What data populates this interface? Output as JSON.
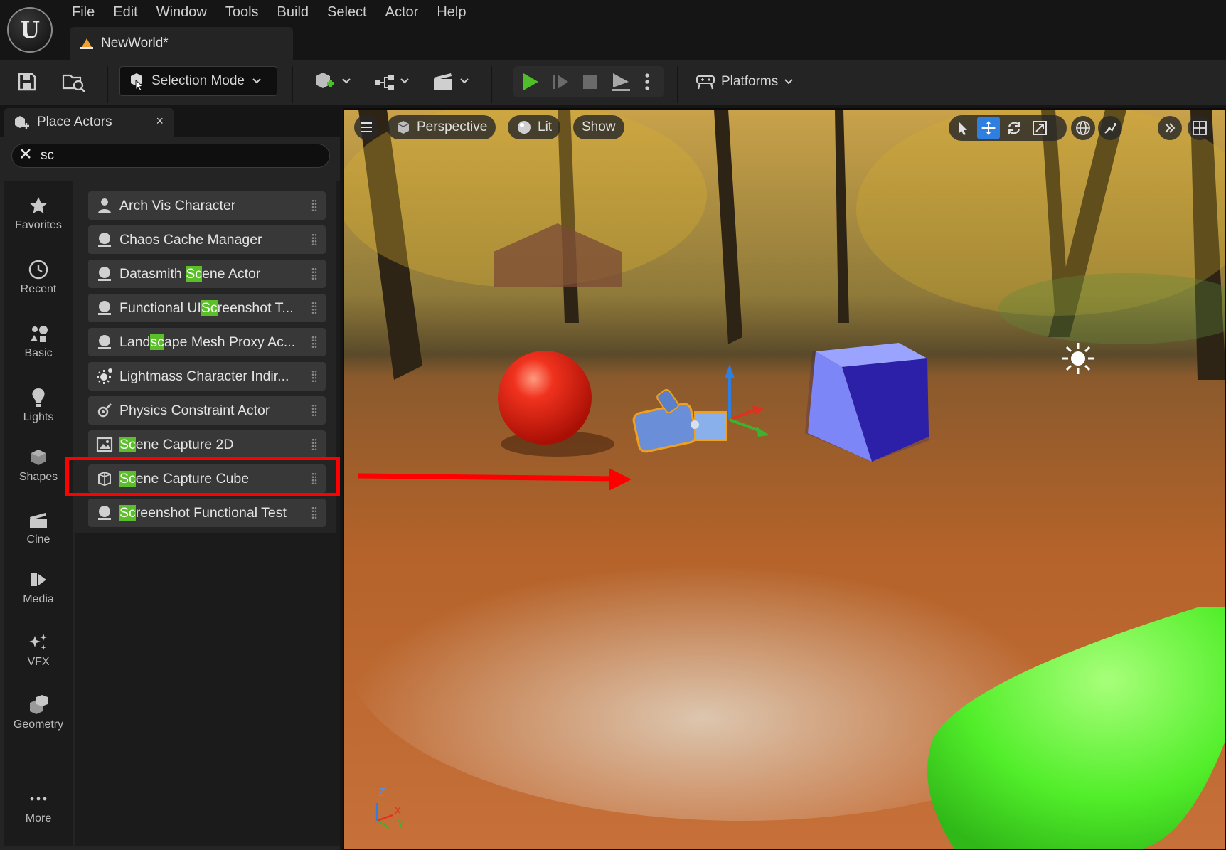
{
  "app": {
    "logo_letter": "U",
    "menu": [
      "File",
      "Edit",
      "Window",
      "Tools",
      "Build",
      "Select",
      "Actor",
      "Help"
    ],
    "document_tab": "NewWorld*"
  },
  "toolbar": {
    "selection_mode": "Selection Mode",
    "platforms": "Platforms"
  },
  "place_actors": {
    "title": "Place Actors",
    "close_glyph": "×",
    "search_value": "sc",
    "categories": [
      {
        "label": "Favorites",
        "icon": "star-icon"
      },
      {
        "label": "Recent",
        "icon": "clock-icon"
      },
      {
        "label": "Basic",
        "icon": "basic-shapes-icon"
      },
      {
        "label": "Lights",
        "icon": "bulb-icon"
      },
      {
        "label": "Shapes",
        "icon": "cube-icon"
      },
      {
        "label": "Cine",
        "icon": "clapper-icon"
      },
      {
        "label": "Media",
        "icon": "media-icon"
      },
      {
        "label": "VFX",
        "icon": "sparkle-icon"
      },
      {
        "label": "Geometry",
        "icon": "geometry-icon"
      },
      {
        "label": "More",
        "icon": "ellipsis-icon"
      }
    ],
    "actors": [
      {
        "pre": "Arch Vis Character",
        "hl": "",
        "post": "",
        "icon": "character-icon"
      },
      {
        "pre": "Chaos Cache Manager",
        "hl": "",
        "post": "",
        "icon": "sphere-icon"
      },
      {
        "pre": "Datasmith ",
        "hl": "Sc",
        "post": "ene Actor",
        "icon": "sphere-icon"
      },
      {
        "pre": "Functional UI",
        "hl": "Sc",
        "post": "reenshot T...",
        "icon": "sphere-icon"
      },
      {
        "pre": "Land",
        "hl": "sc",
        "post": "ape Mesh Proxy Ac...",
        "icon": "sphere-icon"
      },
      {
        "pre": "Lightmass Character Indir...",
        "hl": "",
        "post": "",
        "icon": "light-icon"
      },
      {
        "pre": "Physics Constraint Actor",
        "hl": "",
        "post": "",
        "icon": "constraint-icon"
      },
      {
        "pre": "",
        "hl": "Sc",
        "post": "ene Capture 2D",
        "icon": "capture-2d-icon"
      },
      {
        "pre": "",
        "hl": "Sc",
        "post": "ene Capture Cube",
        "icon": "capture-cube-icon"
      },
      {
        "pre": "",
        "hl": "Sc",
        "post": "reenshot Functional Test",
        "icon": "sphere-icon"
      }
    ]
  },
  "viewport": {
    "perspective": "Perspective",
    "lit": "Lit",
    "show": "Show",
    "axis_labels": {
      "z": "Z",
      "x": "X",
      "y": "Y"
    }
  },
  "colors": {
    "accent_blue": "#2f7fe0",
    "play_green": "#4fbe2a",
    "highlight_green": "#5bbf2a",
    "annotation_red": "#ff0000"
  }
}
